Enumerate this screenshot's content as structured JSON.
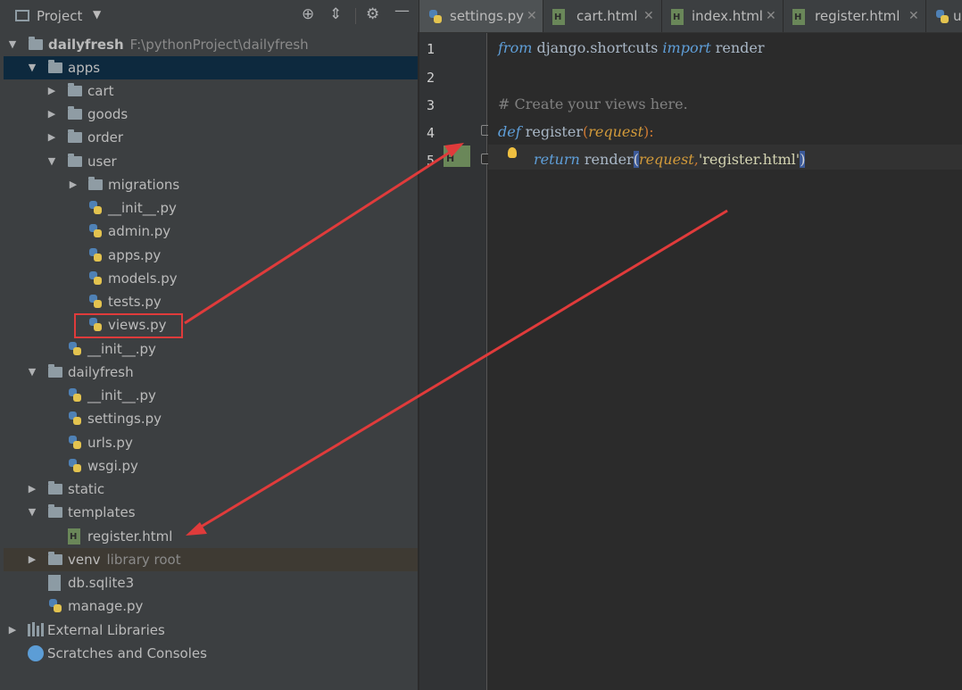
{
  "project": {
    "title": "Project",
    "root_name": "dailyfresh",
    "root_path": "F:\\pythonProject\\dailyfresh",
    "tree": [
      {
        "label": "apps"
      },
      {
        "label": "cart"
      },
      {
        "label": "goods"
      },
      {
        "label": "order"
      },
      {
        "label": "user"
      },
      {
        "label": "migrations"
      },
      {
        "label": "__init__.py"
      },
      {
        "label": "admin.py"
      },
      {
        "label": "apps.py"
      },
      {
        "label": "models.py"
      },
      {
        "label": "tests.py"
      },
      {
        "label": "views.py"
      },
      {
        "label": "__init__.py"
      },
      {
        "label": "dailyfresh"
      },
      {
        "label": "__init__.py"
      },
      {
        "label": "settings.py"
      },
      {
        "label": "urls.py"
      },
      {
        "label": "wsgi.py"
      },
      {
        "label": "static"
      },
      {
        "label": "templates"
      },
      {
        "label": "register.html"
      },
      {
        "label": "venv",
        "sub": "library root"
      },
      {
        "label": "db.sqlite3"
      },
      {
        "label": "manage.py"
      },
      {
        "label": "External Libraries"
      },
      {
        "label": "Scratches and Consoles"
      }
    ]
  },
  "tabs": [
    {
      "label": "settings.py"
    },
    {
      "label": "cart.html"
    },
    {
      "label": "index.html"
    },
    {
      "label": "register.html"
    },
    {
      "label": "u"
    }
  ],
  "editor": {
    "line_numbers": [
      "1",
      "2",
      "3",
      "4",
      "5"
    ],
    "line1": {
      "kw_from": "from",
      "module": " django.shortcuts ",
      "kw_import": "import",
      "name": " render"
    },
    "line3": {
      "comment": "# Create your views here."
    },
    "line4": {
      "kw_def": "def",
      "fn": " register",
      "open": "(",
      "param": "request",
      "close": "):"
    },
    "line5": {
      "kw_return": "return",
      "fn": " render",
      "open": "(",
      "param": "request",
      "comma": ",",
      "str": "'register.html'",
      "close": ")"
    }
  },
  "colors": {
    "annotation": "#e03b3b",
    "selection": "#0d293e"
  }
}
